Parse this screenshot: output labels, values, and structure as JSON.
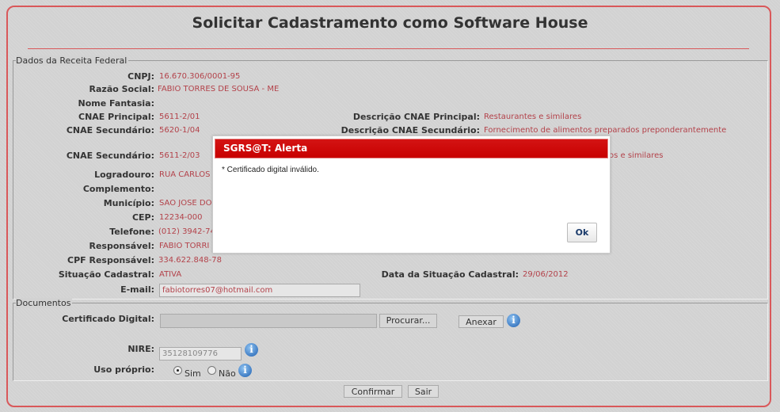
{
  "page": {
    "title": "Solicitar Cadastramento como Software House"
  },
  "receita": {
    "legend": "Dados da Receita Federal",
    "fields": [
      {
        "label": "CNPJ:",
        "value": "16.670.306/0001-95"
      },
      {
        "label": "Razão Social:",
        "value": "FABIO TORRES DE SOUSA - ME"
      },
      {
        "label": "Nome Fantasia:",
        "value": ""
      },
      {
        "label": "CNAE Principal:",
        "value": "5611-2/01"
      },
      {
        "label": "CNAE Secundário:",
        "value": "5620-1/04"
      },
      {
        "label": "CNAE Secundário:",
        "value": "5611-2/03"
      },
      {
        "label": "Logradouro:",
        "value": "RUA CARLOS"
      },
      {
        "label": "Complemento:",
        "value": ""
      },
      {
        "label": "Município:",
        "value": "SAO JOSE DO"
      },
      {
        "label": "CEP:",
        "value": "12234-000"
      },
      {
        "label": "Telefone:",
        "value": "(012) 3942-74"
      },
      {
        "label": "Responsável:",
        "value": "FABIO TORRI"
      },
      {
        "label": "CPF Responsável:",
        "value": "334.622.848-78"
      },
      {
        "label": "Situação Cadastral:",
        "value": "ATIVA"
      },
      {
        "label": "E-mail:",
        "value": "fabiotorres07@hotmail.com"
      }
    ],
    "right": [
      {
        "label": "Descrição CNAE Principal:",
        "value": "Restaurantes e similares"
      },
      {
        "label": "Descrição CNAE Secundário:",
        "value": "Fornecimento de alimentos preparados preponderantemente"
      },
      {
        "label": "",
        "value": "os e similares"
      },
      {
        "label": "Data da Situação Cadastral:",
        "value": "29/06/2012"
      }
    ]
  },
  "documentos": {
    "legend": "Documentos",
    "cert_label": "Certificado Digital:",
    "browse": "Procurar...",
    "attach": "Anexar",
    "nire_label": "NIRE:",
    "nire_value": "35128109776",
    "uso_label": "Uso próprio:",
    "sim": "Sim",
    "nao": "Não",
    "uso_selected": "Sim"
  },
  "actions": {
    "confirm": "Confirmar",
    "exit": "Sair"
  },
  "dialog": {
    "title": "SGRS@T: Alerta",
    "message": "* Certificado digital inválido.",
    "ok": "Ok"
  },
  "icons": {
    "info": "i"
  }
}
